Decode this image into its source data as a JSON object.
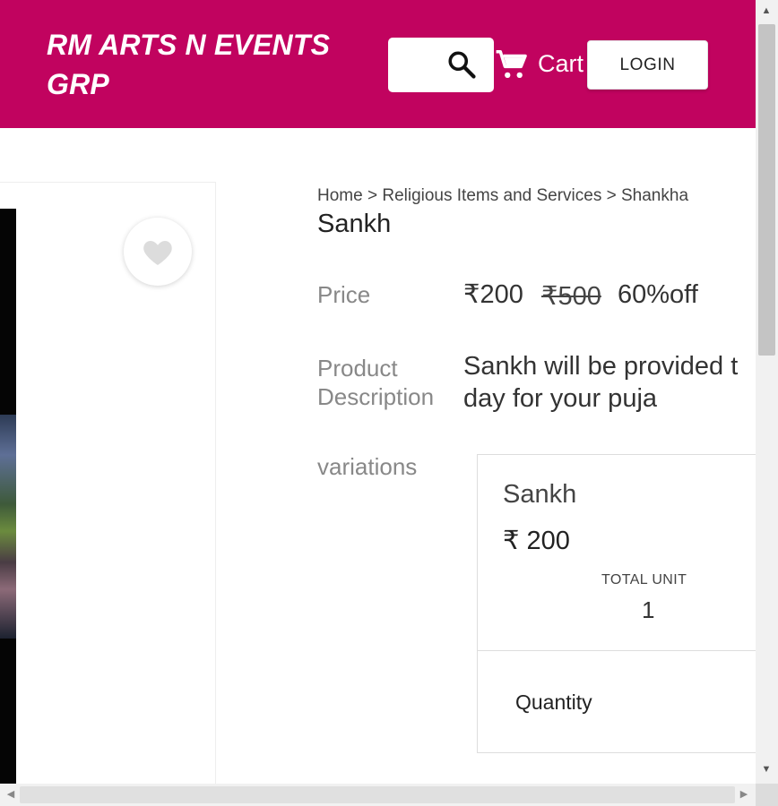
{
  "header": {
    "brand": "RM ARTS N EVENTS GRP",
    "cart_label": "Cart",
    "login_label": "LOGIN",
    "search_icon": "search-icon",
    "cart_icon": "cart-icon",
    "background_color": "#c1035f"
  },
  "breadcrumb": {
    "items": [
      "Home",
      "Religious Items and Services",
      "Shankha"
    ],
    "separator": ">"
  },
  "product": {
    "title": "Sankh",
    "price_label": "Price",
    "price_current": "₹200",
    "price_mrp": "₹500",
    "price_off": "60%off",
    "description_label": "Product Description",
    "description": "Sankh will be provided t day for your puja",
    "description_line1": "Sankh will be provided t",
    "description_line2": "day for your puja",
    "variations_label": "variations",
    "wishlist_icon": "heart-icon"
  },
  "variation": {
    "name": "Sankh",
    "price": "₹ 200",
    "total_unit_label": "TOTAL UNIT",
    "total_unit_value": "1",
    "quantity_label": "Quantity"
  }
}
